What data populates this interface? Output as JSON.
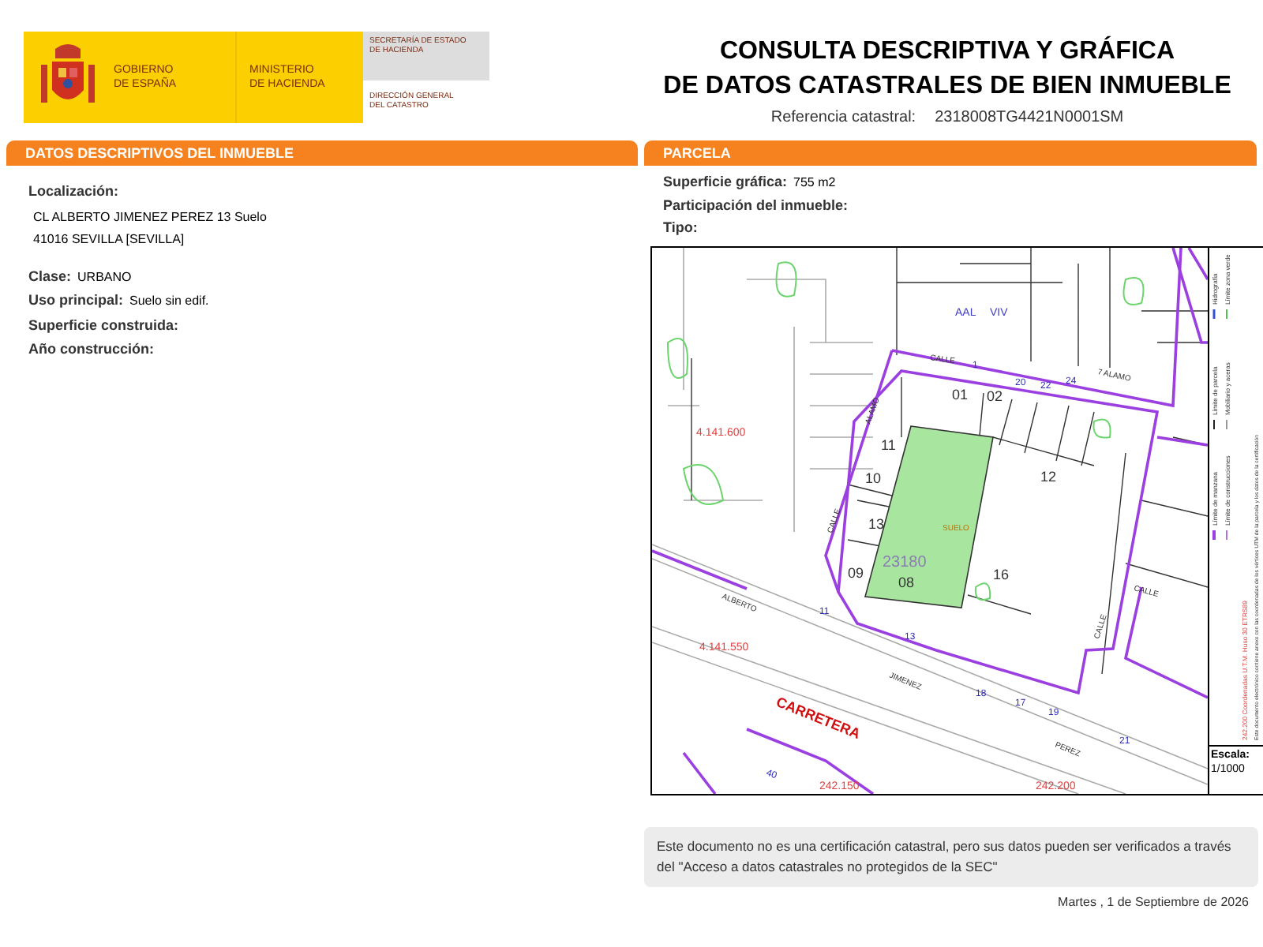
{
  "header": {
    "government": [
      "GOBIERNO",
      "DE ESPAÑA"
    ],
    "ministry": [
      "MINISTERIO",
      "DE HACIENDA"
    ],
    "secretariat": [
      "SECRETARÍA DE ESTADO",
      "DE HACIENDA"
    ],
    "directorate": [
      "DIRECCIÓN GENERAL",
      "DEL CATASTRO"
    ],
    "title": [
      "CONSULTA DESCRIPTIVA Y GRÁFICA",
      "DE DATOS CATASTRALES DE BIEN INMUEBLE"
    ],
    "reference_label": "Referencia catastral:",
    "reference_value": "2318008TG4421N0001SM"
  },
  "descriptive": {
    "title": "DATOS DESCRIPTIVOS DEL INMUEBLE",
    "location_label": "Localización:",
    "location_lines": [
      "CL ALBERTO JIMENEZ PEREZ 13 Suelo",
      "41016 SEVILLA [SEVILLA]"
    ],
    "fields": [
      {
        "label": "Clase:",
        "value": "URBANO"
      },
      {
        "label": "Uso principal:",
        "value": "Suelo sin edif."
      },
      {
        "label": "Superficie construida:"
      },
      {
        "label": "Año construcción:"
      }
    ]
  },
  "parcel": {
    "title": "PARCELA",
    "fields": [
      {
        "label": "Superficie gráfica:",
        "value": "755 m2"
      },
      {
        "label": "Participación del inmueble:"
      },
      {
        "label": "Tipo:"
      }
    ],
    "map_labels": [
      {
        "text": "AAL",
        "kind": "use"
      },
      {
        "text": "VIV",
        "kind": "use"
      },
      {
        "text": "CALLE",
        "kind": "street"
      },
      {
        "text": "01",
        "kind": "parcel"
      },
      {
        "text": "02",
        "kind": "parcel"
      },
      {
        "text": "7 ALAMO",
        "kind": "street"
      },
      {
        "text": "ALAMO",
        "kind": "street"
      },
      {
        "text": "4.141.600",
        "kind": "coord"
      },
      {
        "text": "11",
        "kind": "parcel"
      },
      {
        "text": "10",
        "kind": "parcel"
      },
      {
        "text": "12",
        "kind": "parcel"
      },
      {
        "text": "13",
        "kind": "parcel"
      },
      {
        "text": "SUELO",
        "kind": "use_land"
      },
      {
        "text": "CALLE",
        "kind": "street"
      },
      {
        "text": "09",
        "kind": "parcel"
      },
      {
        "text": "23180",
        "kind": "block"
      },
      {
        "text": "08",
        "kind": "parcel"
      },
      {
        "text": "16",
        "kind": "parcel"
      },
      {
        "text": "ALBERTO",
        "kind": "street"
      },
      {
        "text": "CALLE",
        "kind": "street"
      },
      {
        "text": "CALLE",
        "kind": "street"
      },
      {
        "text": "4.141.550",
        "kind": "coord"
      },
      {
        "text": "CARRETERA",
        "kind": "road"
      },
      {
        "text": "JIMENEZ",
        "kind": "street"
      },
      {
        "text": "PEREZ",
        "kind": "street"
      },
      {
        "text": "242.150",
        "kind": "coord"
      },
      {
        "text": "242.200",
        "kind": "coord"
      },
      {
        "text": "1",
        "kind": "number"
      },
      {
        "text": "20",
        "kind": "number"
      },
      {
        "text": "22",
        "kind": "number"
      },
      {
        "text": "24",
        "kind": "number"
      },
      {
        "text": "11",
        "kind": "number"
      },
      {
        "text": "13",
        "kind": "number"
      },
      {
        "text": "18",
        "kind": "number"
      },
      {
        "text": "17",
        "kind": "number"
      },
      {
        "text": "19",
        "kind": "number"
      },
      {
        "text": "21",
        "kind": "number"
      },
      {
        "text": "40",
        "kind": "number"
      }
    ],
    "legend": [
      {
        "text": "Límite de manzana",
        "kind": "purple"
      },
      {
        "text": "Límite de construcciones",
        "kind": "purple_thin"
      },
      {
        "text": "Límite de parcela",
        "kind": "black"
      },
      {
        "text": "Mobiliario y aceras",
        "kind": "grey"
      },
      {
        "text": "Hidrografía",
        "kind": "blue"
      },
      {
        "text": "Límite zona verde",
        "kind": "green"
      }
    ],
    "coordinates_note": "242.200 Coordenadas U.T.M. Huso 30 ETRS89",
    "electronic_note": "Este documento electrónico contiene anexo con las coordenadas de los vértices UTM de la parcela y los datos de la certificación",
    "scale_label": "Escala:",
    "scale_value": "1/1000"
  },
  "notice": "Este documento no es una certificación catastral, pero sus datos pueden ser verificados a través del \"Acceso a datos catastrales no protegidos de la SEC\"",
  "date": "Martes , 1 de Septiembre de 2026"
}
